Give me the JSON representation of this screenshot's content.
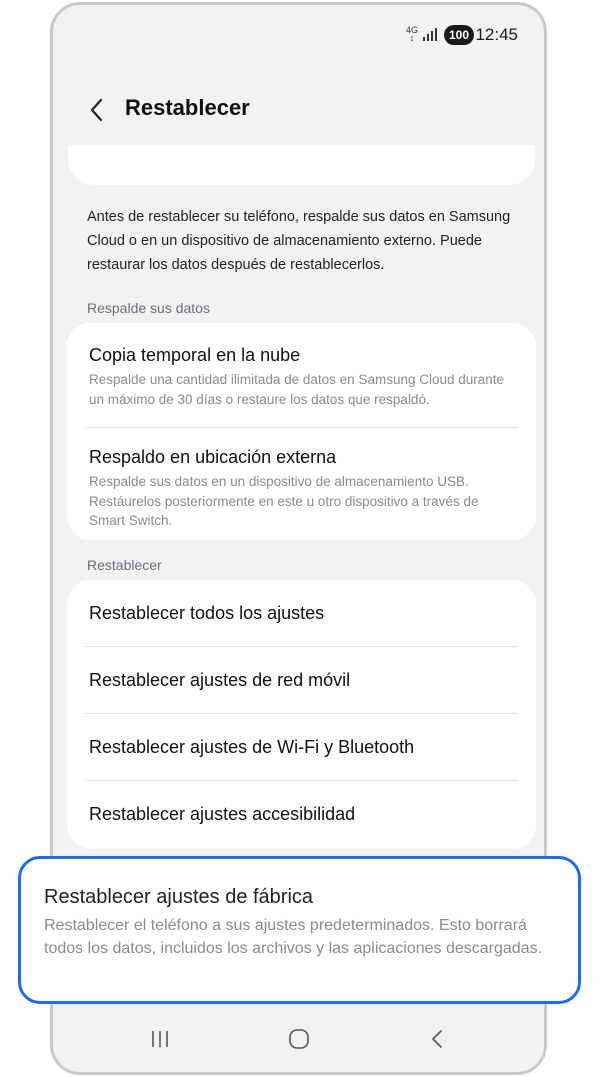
{
  "status_bar": {
    "network": "4G",
    "battery": "100",
    "time": "12:45"
  },
  "header": {
    "title": "Restablecer"
  },
  "description": "Antes de restablecer su teléfono, respalde sus datos en Samsung Cloud o en un dispositivo de almacenamiento externo. Puede restaurar los datos después de restablecerlos.",
  "backup_section": {
    "label": "Respalde sus datos",
    "items": [
      {
        "title": "Copia temporal en la nube",
        "subtitle": "Respalde una cantidad ilimitada de datos en Samsung Cloud durante un máximo de 30 días o restaure los datos que respaldó."
      },
      {
        "title": "Respaldo en ubicación externa",
        "subtitle": "Respalde sus datos en un dispositivo de almacenamiento USB. Restáurelos posteriormente en este u otro dispositivo a través de Smart Switch."
      }
    ]
  },
  "reset_section": {
    "label": "Restablecer",
    "items": [
      {
        "title": "Restablecer todos los ajustes"
      },
      {
        "title": "Restablecer ajustes de red móvil"
      },
      {
        "title": "Restablecer ajustes de Wi-Fi y Bluetooth"
      },
      {
        "title": "Restablecer ajustes accesibilidad"
      }
    ]
  },
  "factory_reset": {
    "title": "Restablecer ajustes de fábrica",
    "subtitle": "Restablecer el teléfono a sus ajustes predeterminados. Esto borrará todos los datos, incluidos los archivos y las aplicaciones descargadas."
  },
  "colors": {
    "accent": "#1e6de6",
    "background": "#f2f2f4"
  },
  "icons": {
    "back": "back-chevron-icon",
    "recents": "recents-icon",
    "home": "home-icon",
    "nav_back": "nav-back-icon"
  }
}
